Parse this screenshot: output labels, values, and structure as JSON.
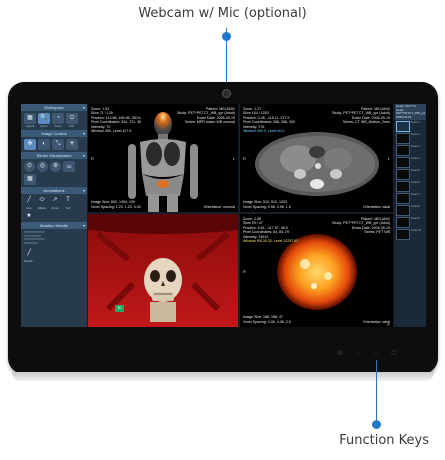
{
  "callouts": {
    "top": "Webcam w/ Mic (optional)",
    "bottom": "Function Keys"
  },
  "colors": {
    "accent": "#1f78c8",
    "panel": "#283b4d",
    "section_header": "#3b5a78"
  },
  "left_panel": {
    "sections": {
      "workspace": "Workspace",
      "image_control": "Image Control",
      "series_visualization": "Series Visualization",
      "annotations": "Annotations",
      "ablation_needle": "Ablation Needle"
    },
    "workspace_tools": [
      {
        "icon": "▦",
        "label": "Layout"
      },
      {
        "icon": "🔍",
        "label": "Zoom"
      },
      {
        "icon": "◔",
        "label": "Cross"
      },
      {
        "icon": "⏻",
        "label": "Exit"
      }
    ],
    "image_control_tools": [
      {
        "icon": "✥"
      },
      {
        "icon": "◐"
      },
      {
        "icon": "⤡"
      },
      {
        "icon": "✳"
      }
    ],
    "visualization_tools": [
      {
        "icon": "⊙"
      },
      {
        "icon": "◎"
      },
      {
        "icon": "⊛"
      },
      {
        "icon": "3D"
      },
      {
        "icon": "▦"
      }
    ],
    "annotation_tools": [
      {
        "icon": "╱",
        "label": "Line"
      },
      {
        "icon": "⬭",
        "label": "Ellipse"
      },
      {
        "icon": "↗",
        "label": "Arrow"
      },
      {
        "icon": "T",
        "label": "Text"
      },
      {
        "icon": "★",
        "label": ""
      }
    ],
    "ablation_tool": {
      "icon": "╱",
      "label": "Needle"
    }
  },
  "viewports": [
    {
      "top_left": [
        "Zoom: 1.53",
        "Slice 71 / 139",
        "Position: 113.86, 165.96, 350.6",
        "Pixel Coordinates: 324, 721, 36",
        "Intensity: 70",
        "Window 350, Level 127.9"
      ],
      "top_right": [
        "Patient: MELANIX",
        "Study: PET^PETCT_WB_ypr (Adult)",
        "Exam Date: 2006-09-19",
        "Series: MPR fusion WB coronal"
      ],
      "bottom_left": [
        "Image Size: 600, 1454, 139",
        "Voxel Spacing: 1.23, 1.23, 4.00"
      ],
      "bottom_right": [
        "Orientation: coronal"
      ],
      "marker_left": "R",
      "marker_right": "L"
    },
    {
      "top_left": [
        "Zoom: 1.27",
        "Slice 164 / 1203",
        "Position: 0.46, -116.11, 317.5",
        "Pixel Coordinates: 256, 256, 309",
        "Intensity: 276",
        "Window 400.0, Level 40.0"
      ],
      "top_right": [
        "Patient: MELANIX",
        "Study: PET^PETCT_WB_ypr (Adult)",
        "Exam Date: 2006-09-19",
        "Series: CT WB_fixation_2mm"
      ],
      "bottom_left": [
        "Image Size: 512, 512, 1203",
        "Voxel Spacing: 0.98, 0.98, 1.5"
      ],
      "bottom_right": [
        "Orientation: axial"
      ],
      "marker_left": "R",
      "marker_right": "L"
    },
    {
      "badge": "3D",
      "marker_left": "",
      "marker_right": ""
    },
    {
      "top_left": [
        "Zoom: 2.56",
        "Slice 29 / 47",
        "Position: 5.61, -117.57, 48.0",
        "Pixel Coordinates: 84, 84, 29",
        "Intensity: 14612",
        "Window 90139.33, Level 12297.67"
      ],
      "top_right": [
        "Patient: MELANIX",
        "Study: PET^PETCT_WB_ypr (Adult)",
        "Exam Date: 2006-09-19",
        "Series: PET WB"
      ],
      "bottom_left": [
        "Image Size: 168, 168, 47",
        "Voxel Spacing: 4.06, 4.06, 2.5"
      ],
      "bottom_right": [
        "Orientation: axial"
      ],
      "marker_left": "R",
      "marker_right": "P"
    }
  ],
  "right_panel": {
    "header": [
      "Hoplz: PET^CT",
      "Study: PET^PETCT_WB_ypr",
      "2006-09-19"
    ],
    "thumbnails": [
      {
        "info": "Series 1"
      },
      {
        "info": "Series 2"
      },
      {
        "info": "Series 3"
      },
      {
        "info": "Series 4"
      },
      {
        "info": "Series 5"
      },
      {
        "info": "Series 6"
      },
      {
        "info": "Series 7"
      },
      {
        "info": "Series 8"
      },
      {
        "info": "Series 9"
      },
      {
        "info": "Series 10"
      }
    ]
  },
  "function_keys": [
    "⚙",
    "⋮",
    "○",
    "⏻"
  ]
}
